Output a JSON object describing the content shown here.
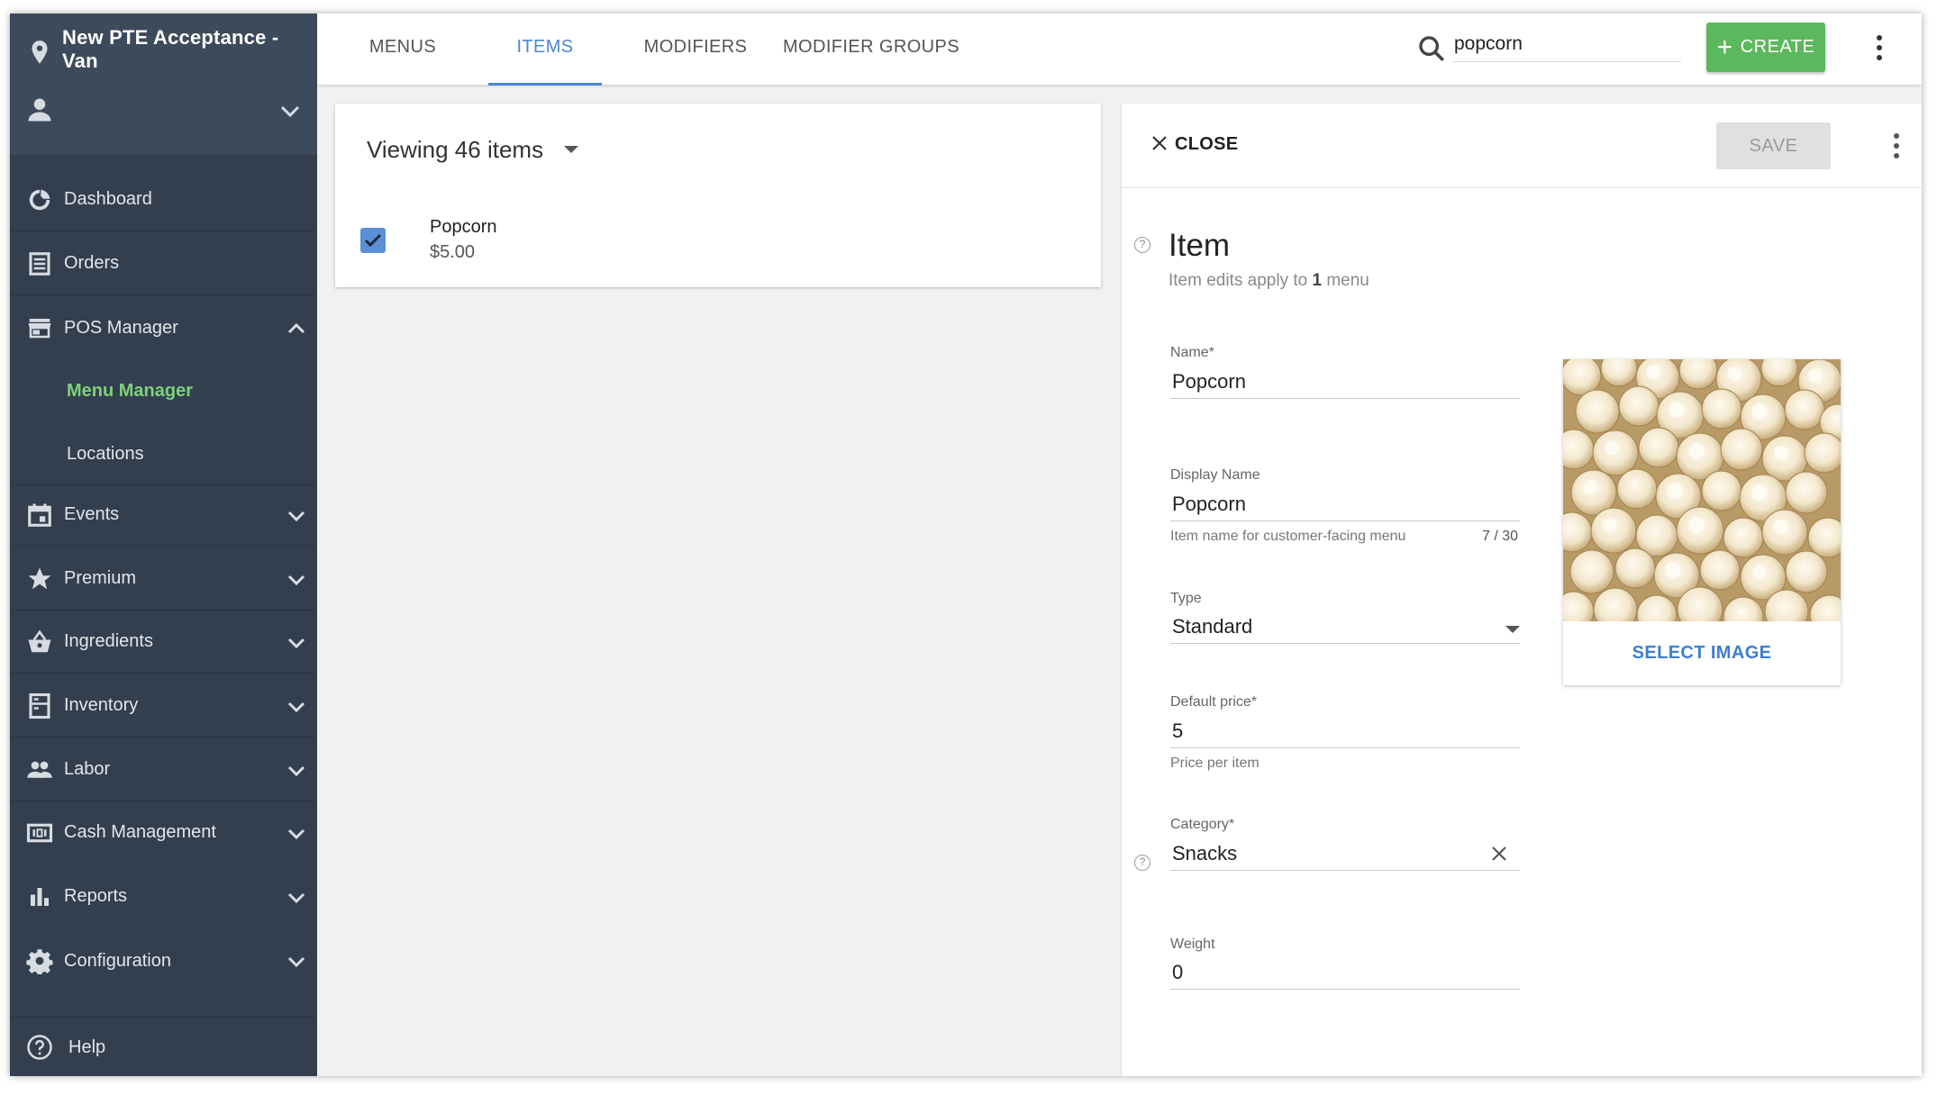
{
  "sidebar": {
    "location_title": "New PTE Acceptance - Van",
    "items": [
      {
        "label": "Dashboard"
      },
      {
        "label": "Orders"
      },
      {
        "label": "POS Manager"
      },
      {
        "label": "Events"
      },
      {
        "label": "Premium"
      },
      {
        "label": "Ingredients"
      },
      {
        "label": "Inventory"
      },
      {
        "label": "Labor"
      },
      {
        "label": "Cash Management"
      },
      {
        "label": "Reports"
      },
      {
        "label": "Configuration"
      }
    ],
    "sub_items": [
      {
        "label": "Menu Manager",
        "active": true
      },
      {
        "label": "Locations",
        "active": false
      }
    ],
    "help_label": "Help",
    "active_color": "#7cd27a",
    "background": "#333f4e"
  },
  "topbar": {
    "tabs": [
      {
        "label": "MENUS"
      },
      {
        "label": "ITEMS",
        "active": true
      },
      {
        "label": "MODIFIERS"
      },
      {
        "label": "MODIFIER GROUPS"
      }
    ],
    "search_value": "popcorn",
    "create_label": "CREATE",
    "accent_color": "#4a86d4",
    "create_color": "#5cb85c"
  },
  "list": {
    "viewing_label": "Viewing 46 items",
    "rows": [
      {
        "name": "Popcorn",
        "price": "$5.00",
        "checked": true
      }
    ]
  },
  "detail": {
    "close_label": "CLOSE",
    "save_label": "SAVE",
    "section_title": "Item",
    "section_sub_pre": "Item edits apply to ",
    "section_sub_count": "1",
    "section_sub_post": " menu",
    "fields": {
      "name": {
        "label": "Name",
        "required": "*",
        "value": "Popcorn"
      },
      "display_name": {
        "label": "Display Name",
        "value": "Popcorn",
        "hint": "Item name for customer-facing menu",
        "counter": "7 / 30"
      },
      "type": {
        "label": "Type",
        "value": "Standard"
      },
      "default_price": {
        "label": "Default price",
        "required": "*",
        "value": "5",
        "hint": "Price per item"
      },
      "category": {
        "label": "Category",
        "required": "*",
        "value": "Snacks"
      },
      "weight": {
        "label": "Weight",
        "value": "0"
      }
    },
    "select_image_label": "SELECT IMAGE"
  }
}
